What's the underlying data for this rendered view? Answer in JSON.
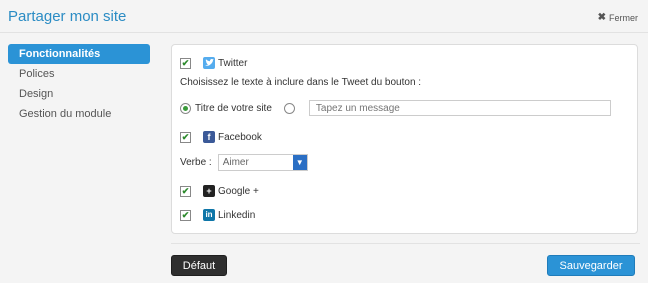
{
  "header": {
    "title": "Partager mon site",
    "close_label": "Fermer"
  },
  "sidebar": {
    "items": [
      {
        "label": "Fonctionnalités",
        "active": true
      },
      {
        "label": "Polices"
      },
      {
        "label": "Design"
      },
      {
        "label": "Gestion du module"
      }
    ]
  },
  "panel": {
    "twitter": {
      "label": "Twitter",
      "checked": true
    },
    "tweet_prompt": "Choisissez le texte à inclure dans le Tweet du bouton :",
    "radio_site": {
      "label": "Titre de votre site",
      "selected": true
    },
    "message_input": {
      "placeholder": "Tapez un message",
      "value": ""
    },
    "facebook": {
      "label": "Facebook",
      "checked": true
    },
    "verb": {
      "label": "Verbe :",
      "value": "Aimer"
    },
    "google": {
      "label": "Google +",
      "checked": true
    },
    "linkedin": {
      "label": "Linkedin",
      "checked": true
    }
  },
  "footer": {
    "default_label": "Défaut",
    "save_label": "Sauvegarder"
  },
  "colors": {
    "accent": "#2b93d6",
    "title": "#2b8cc4",
    "twitter": "#55acee",
    "facebook": "#3b5998",
    "google": "#222222",
    "linkedin": "#0e76a8"
  },
  "icons": {
    "twitter": "twitter-icon",
    "facebook": "facebook-icon",
    "google": "google-plus-icon",
    "linkedin": "linkedin-icon",
    "close": "close-icon"
  }
}
